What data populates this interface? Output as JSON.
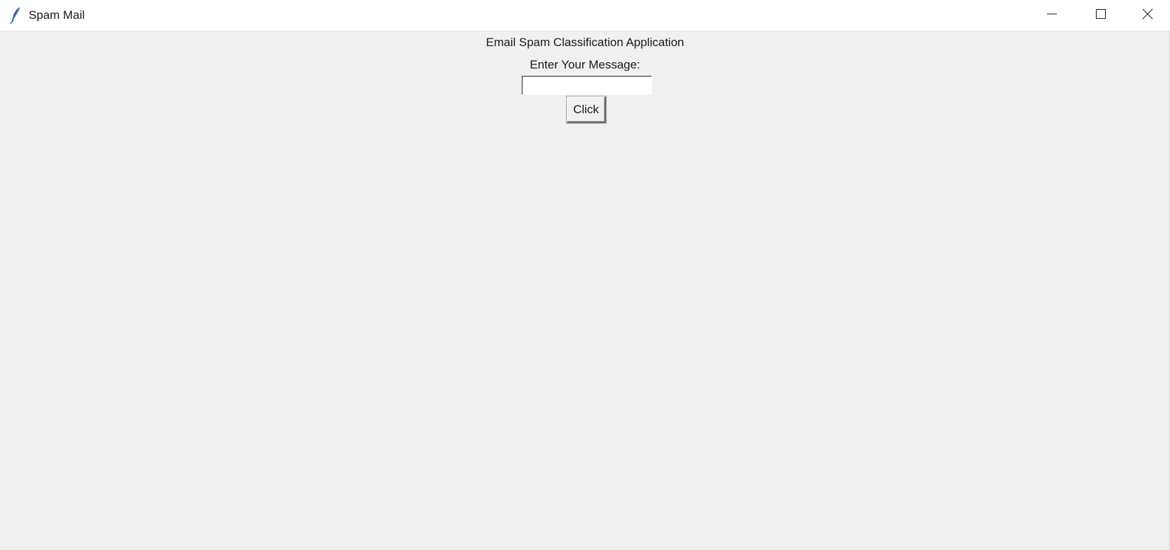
{
  "window": {
    "title": "Spam Mail",
    "app_icon": "feather-icon",
    "controls": {
      "minimize_icon": "minimize-icon",
      "maximize_icon": "maximize-icon",
      "close_icon": "close-icon"
    }
  },
  "main": {
    "heading": "Email Spam Classification Application",
    "prompt": "Enter Your Message:",
    "message_input": {
      "value": "",
      "placeholder": ""
    },
    "submit_label": "Click"
  },
  "colors": {
    "background": "#f0f0f0",
    "titlebar": "#ffffff",
    "text": "#1a1a1a"
  }
}
